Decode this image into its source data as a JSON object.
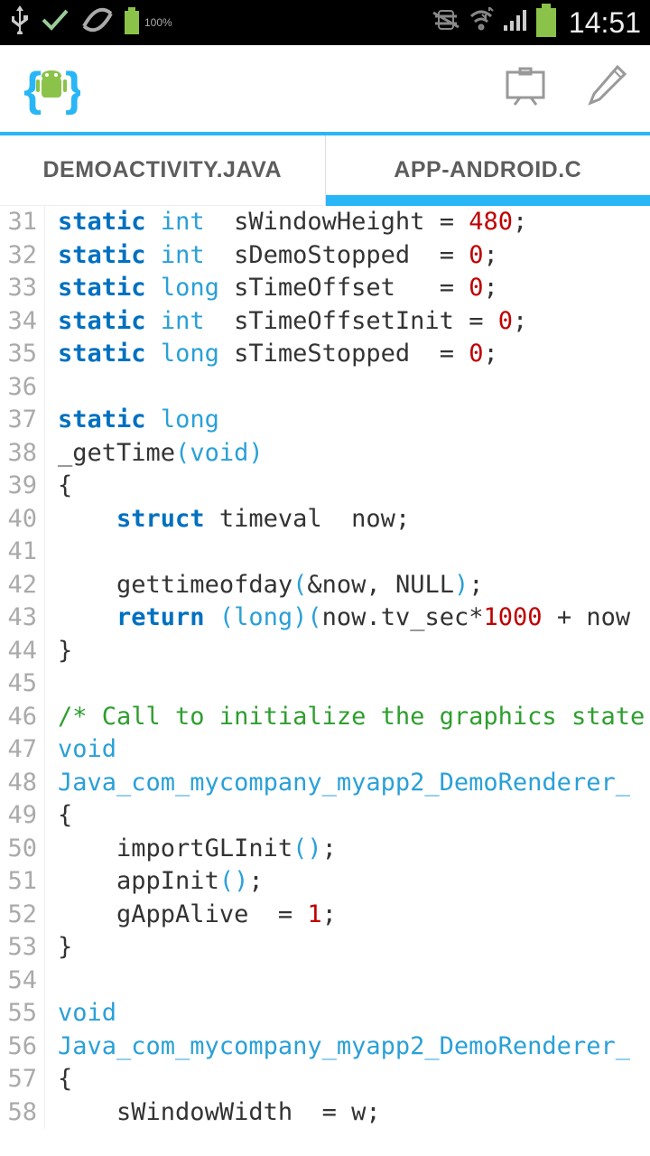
{
  "status": {
    "battery_pct": "100%",
    "clock": "14:51"
  },
  "tabs": [
    {
      "label": "DEMOACTIVITY.JAVA",
      "active": false
    },
    {
      "label": "APP-ANDROID.C",
      "active": true
    }
  ],
  "editor": {
    "first_line": 31,
    "code_lines": [
      [
        [
          "kw",
          "static"
        ],
        [
          "sp",
          " "
        ],
        [
          "tp",
          "int"
        ],
        [
          "sp",
          "  "
        ],
        [
          "id",
          "sWindowHeight"
        ],
        [
          "sp",
          " "
        ],
        [
          "op",
          "="
        ],
        [
          "sp",
          " "
        ],
        [
          "num",
          "480"
        ],
        [
          "op",
          ";"
        ]
      ],
      [
        [
          "kw",
          "static"
        ],
        [
          "sp",
          " "
        ],
        [
          "tp",
          "int"
        ],
        [
          "sp",
          "  "
        ],
        [
          "id",
          "sDemoStopped"
        ],
        [
          "sp",
          "  "
        ],
        [
          "op",
          "="
        ],
        [
          "sp",
          " "
        ],
        [
          "num",
          "0"
        ],
        [
          "op",
          ";"
        ]
      ],
      [
        [
          "kw",
          "static"
        ],
        [
          "sp",
          " "
        ],
        [
          "tp",
          "long"
        ],
        [
          "sp",
          " "
        ],
        [
          "id",
          "sTimeOffset"
        ],
        [
          "sp",
          "   "
        ],
        [
          "op",
          "="
        ],
        [
          "sp",
          " "
        ],
        [
          "num",
          "0"
        ],
        [
          "op",
          ";"
        ]
      ],
      [
        [
          "kw",
          "static"
        ],
        [
          "sp",
          " "
        ],
        [
          "tp",
          "int"
        ],
        [
          "sp",
          "  "
        ],
        [
          "id",
          "sTimeOffsetInit"
        ],
        [
          "sp",
          " "
        ],
        [
          "op",
          "="
        ],
        [
          "sp",
          " "
        ],
        [
          "num",
          "0"
        ],
        [
          "op",
          ";"
        ]
      ],
      [
        [
          "kw",
          "static"
        ],
        [
          "sp",
          " "
        ],
        [
          "tp",
          "long"
        ],
        [
          "sp",
          " "
        ],
        [
          "id",
          "sTimeStopped"
        ],
        [
          "sp",
          "  "
        ],
        [
          "op",
          "="
        ],
        [
          "sp",
          " "
        ],
        [
          "num",
          "0"
        ],
        [
          "op",
          ";"
        ]
      ],
      [],
      [
        [
          "kw",
          "static"
        ],
        [
          "sp",
          " "
        ],
        [
          "tp",
          "long"
        ]
      ],
      [
        [
          "id",
          "_getTime"
        ],
        [
          "pn",
          "("
        ],
        [
          "tp",
          "void"
        ],
        [
          "pn",
          ")"
        ]
      ],
      [
        [
          "op",
          "{"
        ]
      ],
      [
        [
          "sp",
          "    "
        ],
        [
          "kw",
          "struct"
        ],
        [
          "sp",
          " "
        ],
        [
          "id",
          "timeval"
        ],
        [
          "sp",
          "  "
        ],
        [
          "id",
          "now"
        ],
        [
          "op",
          ";"
        ]
      ],
      [],
      [
        [
          "sp",
          "    "
        ],
        [
          "id",
          "gettimeofday"
        ],
        [
          "pn",
          "("
        ],
        [
          "op",
          "&"
        ],
        [
          "id",
          "now"
        ],
        [
          "op",
          ","
        ],
        [
          "sp",
          " "
        ],
        [
          "id",
          "NULL"
        ],
        [
          "pn",
          ")"
        ],
        [
          "op",
          ";"
        ]
      ],
      [
        [
          "sp",
          "    "
        ],
        [
          "kw",
          "return"
        ],
        [
          "sp",
          " "
        ],
        [
          "pn",
          "("
        ],
        [
          "tp",
          "long"
        ],
        [
          "pn",
          ")("
        ],
        [
          "id",
          "now"
        ],
        [
          "op",
          "."
        ],
        [
          "id",
          "tv_sec"
        ],
        [
          "op",
          "*"
        ],
        [
          "num",
          "1000"
        ],
        [
          "sp",
          " "
        ],
        [
          "op",
          "+"
        ],
        [
          "sp",
          " "
        ],
        [
          "id",
          "now"
        ]
      ],
      [
        [
          "op",
          "}"
        ]
      ],
      [],
      [
        [
          "cm",
          "/* Call to initialize the graphics state"
        ]
      ],
      [
        [
          "tp",
          "void"
        ]
      ],
      [
        [
          "fn",
          "Java_com_mycompany_myapp2_DemoRenderer_"
        ]
      ],
      [
        [
          "op",
          "{"
        ]
      ],
      [
        [
          "sp",
          "    "
        ],
        [
          "id",
          "importGLInit"
        ],
        [
          "pn",
          "()"
        ],
        [
          "op",
          ";"
        ]
      ],
      [
        [
          "sp",
          "    "
        ],
        [
          "id",
          "appInit"
        ],
        [
          "pn",
          "()"
        ],
        [
          "op",
          ";"
        ]
      ],
      [
        [
          "sp",
          "    "
        ],
        [
          "id",
          "gAppAlive"
        ],
        [
          "sp",
          "  "
        ],
        [
          "op",
          "="
        ],
        [
          "sp",
          " "
        ],
        [
          "num",
          "1"
        ],
        [
          "op",
          ";"
        ]
      ],
      [
        [
          "op",
          "}"
        ]
      ],
      [],
      [
        [
          "tp",
          "void"
        ]
      ],
      [
        [
          "fn",
          "Java_com_mycompany_myapp2_DemoRenderer_"
        ]
      ],
      [
        [
          "op",
          "{"
        ]
      ],
      [
        [
          "sp",
          "    "
        ],
        [
          "id",
          "sWindowWidth"
        ],
        [
          "sp",
          "  "
        ],
        [
          "op",
          "="
        ],
        [
          "sp",
          " "
        ],
        [
          "id",
          "w"
        ],
        [
          "op",
          ";"
        ]
      ]
    ]
  }
}
